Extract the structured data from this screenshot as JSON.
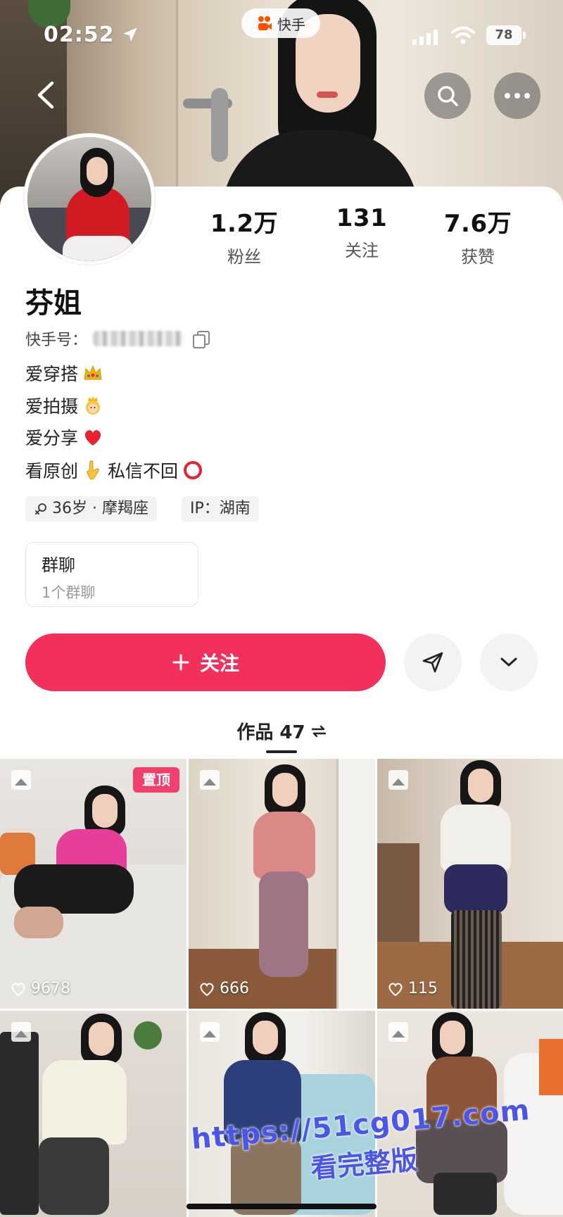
{
  "status_bar": {
    "time": "02:52",
    "battery": "78"
  },
  "app_badge": {
    "label": "快手"
  },
  "profile": {
    "name": "芬姐",
    "kuaishou_id_label": "快手号：",
    "stats": [
      {
        "value": "1.2万",
        "label": "粉丝"
      },
      {
        "value": "131",
        "label": "关注"
      },
      {
        "value": "7.6万",
        "label": "获赞"
      }
    ],
    "bio": [
      {
        "text": "爱穿搭",
        "emoji": "crown-icon"
      },
      {
        "text": "爱拍摄",
        "emoji": "princess-icon"
      },
      {
        "text": "爱分享",
        "emoji": "heart-icon"
      },
      {
        "text": "看原创",
        "emoji": "pointing-down-icon",
        "text2": "私信不回",
        "emoji2": "circle-icon"
      }
    ],
    "tags": {
      "age": "36岁 · 摩羯座",
      "ip": "IP：湖南"
    },
    "group": {
      "title": "群聊",
      "subtitle": "1个群聊"
    },
    "follow_label": "关注"
  },
  "works": {
    "label": "作品 47"
  },
  "grid": [
    {
      "likes": "9678",
      "pinned": "置顶"
    },
    {
      "likes": "666"
    },
    {
      "likes": "115"
    },
    {
      "likes": ""
    },
    {
      "likes": ""
    },
    {
      "likes": ""
    }
  ],
  "watermark": {
    "url": "https://51cg017.com",
    "text": "看完整版"
  },
  "colors": {
    "accent": "#f1315c",
    "pin": "#f0406b",
    "watermark": "#4b56e6"
  }
}
